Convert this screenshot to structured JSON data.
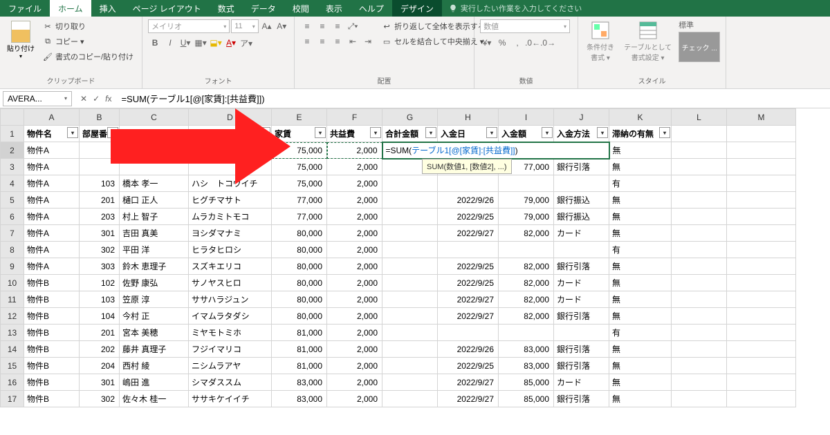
{
  "tabs": {
    "file": "ファイル",
    "home": "ホーム",
    "insert": "挿入",
    "layout": "ページ レイアウト",
    "formulas": "数式",
    "data": "データ",
    "review": "校閲",
    "view": "表示",
    "help": "ヘルプ",
    "design": "デザイン"
  },
  "tellme": "実行したい作業を入力してください",
  "ribbon": {
    "clipboard": {
      "label": "クリップボード",
      "paste": "貼り付け",
      "cut": "切り取り",
      "copy": "コピー ▾",
      "format": "書式のコピー/貼り付け"
    },
    "font": {
      "label": "フォント",
      "name": "メイリオ",
      "size": "11"
    },
    "align": {
      "label": "配置",
      "wrap": "折り返して全体を表示する",
      "merge": "セルを結合して中央揃え ▾"
    },
    "number": {
      "label": "数値",
      "format": "数値"
    },
    "styles": {
      "label": "スタイル",
      "cond": "条件付き\n書式 ▾",
      "table": "テーブルとして\n書式設定 ▾",
      "std": "標準",
      "chip": "チェック ..."
    }
  },
  "namebox": "AVERA...",
  "formula": "=SUM(テーブル1[@[家賃]:[共益費]])",
  "formula_edit": {
    "pre": "=SUM(",
    "ref": "テーブル1[@[家賃]:[共益費]]",
    "post": ")"
  },
  "tooltip": "SUM(数値1, [数値2], ...)",
  "cols": [
    "A",
    "B",
    "C",
    "D",
    "E",
    "F",
    "G",
    "H",
    "I",
    "J",
    "K",
    "L",
    "M"
  ],
  "headers": [
    "物件名",
    "部屋番",
    "",
    "",
    "家賃",
    "共益費",
    "合計金額",
    "入金日",
    "入金額",
    "入金方法",
    "滞納の有無"
  ],
  "rows": [
    {
      "r": 2,
      "a": "物件A",
      "b": "",
      "c": "",
      "d": "",
      "e": "75,000",
      "f": "2,000",
      "g": "",
      "h": "",
      "i": "",
      "j": "",
      "k": "無"
    },
    {
      "r": 3,
      "a": "物件A",
      "b": "",
      "c": "",
      "d": "",
      "e": "75,000",
      "f": "2,000",
      "g": "",
      "h": "",
      "i": "77,000",
      "j": "銀行引落",
      "k": "無"
    },
    {
      "r": 4,
      "a": "物件A",
      "b": "103",
      "c": "橋本 孝一",
      "d": "ハシ　トコウイチ",
      "e": "75,000",
      "f": "2,000",
      "g": "",
      "h": "",
      "i": "",
      "j": "",
      "k": "有"
    },
    {
      "r": 5,
      "a": "物件A",
      "b": "201",
      "c": "樋口 正人",
      "d": "ヒグチマサト",
      "e": "77,000",
      "f": "2,000",
      "g": "",
      "h": "2022/9/26",
      "i": "79,000",
      "j": "銀行振込",
      "k": "無"
    },
    {
      "r": 6,
      "a": "物件A",
      "b": "203",
      "c": "村上 智子",
      "d": "ムラカミトモコ",
      "e": "77,000",
      "f": "2,000",
      "g": "",
      "h": "2022/9/25",
      "i": "79,000",
      "j": "銀行振込",
      "k": "無"
    },
    {
      "r": 7,
      "a": "物件A",
      "b": "301",
      "c": "吉田 真美",
      "d": "ヨシダマナミ",
      "e": "80,000",
      "f": "2,000",
      "g": "",
      "h": "2022/9/27",
      "i": "82,000",
      "j": "カード",
      "k": "無"
    },
    {
      "r": 8,
      "a": "物件A",
      "b": "302",
      "c": "平田 洋",
      "d": "ヒラタヒロシ",
      "e": "80,000",
      "f": "2,000",
      "g": "",
      "h": "",
      "i": "",
      "j": "",
      "k": "有"
    },
    {
      "r": 9,
      "a": "物件A",
      "b": "303",
      "c": "鈴木 恵理子",
      "d": "スズキエリコ",
      "e": "80,000",
      "f": "2,000",
      "g": "",
      "h": "2022/9/25",
      "i": "82,000",
      "j": "銀行引落",
      "k": "無"
    },
    {
      "r": 10,
      "a": "物件B",
      "b": "102",
      "c": "佐野 康弘",
      "d": "サノヤスヒロ",
      "e": "80,000",
      "f": "2,000",
      "g": "",
      "h": "2022/9/25",
      "i": "82,000",
      "j": "カード",
      "k": "無"
    },
    {
      "r": 11,
      "a": "物件B",
      "b": "103",
      "c": "笠原 淳",
      "d": "ササハラジュン",
      "e": "80,000",
      "f": "2,000",
      "g": "",
      "h": "2022/9/27",
      "i": "82,000",
      "j": "カード",
      "k": "無"
    },
    {
      "r": 12,
      "a": "物件B",
      "b": "104",
      "c": "今村 正",
      "d": "イマムラタダシ",
      "e": "80,000",
      "f": "2,000",
      "g": "",
      "h": "2022/9/27",
      "i": "82,000",
      "j": "銀行引落",
      "k": "無"
    },
    {
      "r": 13,
      "a": "物件B",
      "b": "201",
      "c": "宮本 美穂",
      "d": "ミヤモトミホ",
      "e": "81,000",
      "f": "2,000",
      "g": "",
      "h": "",
      "i": "",
      "j": "",
      "k": "有"
    },
    {
      "r": 14,
      "a": "物件B",
      "b": "202",
      "c": "藤井 真理子",
      "d": "フジイマリコ",
      "e": "81,000",
      "f": "2,000",
      "g": "",
      "h": "2022/9/26",
      "i": "83,000",
      "j": "銀行引落",
      "k": "無"
    },
    {
      "r": 15,
      "a": "物件B",
      "b": "204",
      "c": "西村 綾",
      "d": "ニシムラアヤ",
      "e": "81,000",
      "f": "2,000",
      "g": "",
      "h": "2022/9/25",
      "i": "83,000",
      "j": "銀行引落",
      "k": "無"
    },
    {
      "r": 16,
      "a": "物件B",
      "b": "301",
      "c": "嶋田 進",
      "d": "シマダススム",
      "e": "83,000",
      "f": "2,000",
      "g": "",
      "h": "2022/9/27",
      "i": "85,000",
      "j": "カード",
      "k": "無"
    },
    {
      "r": 17,
      "a": "物件B",
      "b": "302",
      "c": "佐々木 桂一",
      "d": "ササキケイイチ",
      "e": "83,000",
      "f": "2,000",
      "g": "",
      "h": "2022/9/27",
      "i": "85,000",
      "j": "銀行引落",
      "k": "無"
    }
  ]
}
